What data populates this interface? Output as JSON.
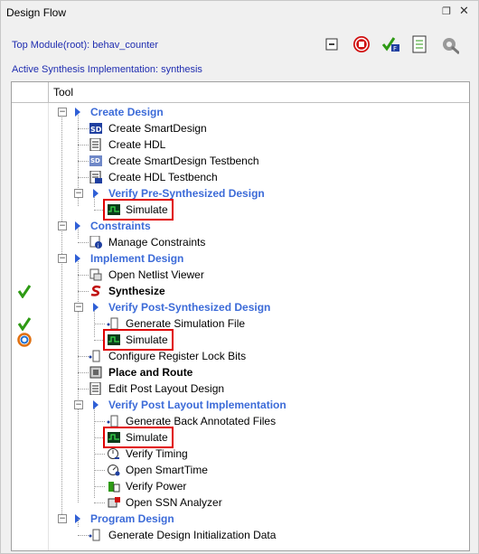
{
  "window": {
    "title": "Design Flow"
  },
  "info": {
    "top_module": "Top Module(root): behav_counter",
    "active_synthesis": "Active Synthesis Implementation: synthesis"
  },
  "toolbar": {
    "icons": [
      "collapse-icon",
      "stop-icon",
      "check-hdl-icon",
      "report-icon",
      "options-icon"
    ]
  },
  "column": {
    "tool": "Tool"
  },
  "colors": {
    "category": "#3c6bd8",
    "highlight": "#e00000",
    "check": "#2e9a14"
  },
  "tree": [
    {
      "label": "Create Design",
      "kind": "category",
      "icon": "expander"
    },
    {
      "label": "Create SmartDesign",
      "kind": "item",
      "icon": "smartdesign-icon"
    },
    {
      "label": "Create HDL",
      "kind": "item",
      "icon": "hdl-file-icon"
    },
    {
      "label": "Create SmartDesign Testbench",
      "kind": "item",
      "icon": "smartdesign-testbench-icon"
    },
    {
      "label": "Create HDL Testbench",
      "kind": "item",
      "icon": "hdl-testbench-icon"
    },
    {
      "label": "Verify Pre-Synthesized Design",
      "kind": "category",
      "icon": "expander"
    },
    {
      "label": "Simulate",
      "kind": "item",
      "icon": "simulate-icon",
      "highlight": true
    },
    {
      "label": "Constraints",
      "kind": "category",
      "icon": "expander"
    },
    {
      "label": "Manage Constraints",
      "kind": "item",
      "icon": "constraints-icon"
    },
    {
      "label": "Implement Design",
      "kind": "category",
      "icon": "expander"
    },
    {
      "label": "Open Netlist Viewer",
      "kind": "item",
      "icon": "netlist-viewer-icon"
    },
    {
      "label": "Synthesize",
      "kind": "bold",
      "icon": "synthesize-icon",
      "status": "check"
    },
    {
      "label": "Verify Post-Synthesized Design",
      "kind": "category",
      "icon": "expander"
    },
    {
      "label": "Generate Simulation File",
      "kind": "item",
      "icon": "generate-file-icon"
    },
    {
      "label": "Simulate",
      "kind": "item",
      "icon": "simulate-icon",
      "highlight": true,
      "status": "check-running"
    },
    {
      "label": "Configure Register Lock Bits",
      "kind": "item",
      "icon": "generate-file-icon"
    },
    {
      "label": "Place and Route",
      "kind": "bold",
      "icon": "place-route-icon"
    },
    {
      "label": "Edit Post Layout Design",
      "kind": "item",
      "icon": "edit-layout-icon"
    },
    {
      "label": "Verify Post Layout Implementation",
      "kind": "category",
      "icon": "expander"
    },
    {
      "label": "Generate Back Annotated Files",
      "kind": "item",
      "icon": "generate-file-icon"
    },
    {
      "label": "Simulate",
      "kind": "item",
      "icon": "simulate-icon",
      "highlight": true
    },
    {
      "label": "Verify Timing",
      "kind": "item",
      "icon": "verify-timing-icon"
    },
    {
      "label": "Open SmartTime",
      "kind": "item",
      "icon": "smarttime-icon"
    },
    {
      "label": "Verify Power",
      "kind": "item",
      "icon": "verify-power-icon"
    },
    {
      "label": "Open SSN Analyzer",
      "kind": "item",
      "icon": "ssn-analyzer-icon"
    },
    {
      "label": "Program Design",
      "kind": "category",
      "icon": "expander"
    },
    {
      "label": "Generate Design Initialization Data",
      "kind": "item",
      "icon": "generate-file-icon"
    }
  ]
}
